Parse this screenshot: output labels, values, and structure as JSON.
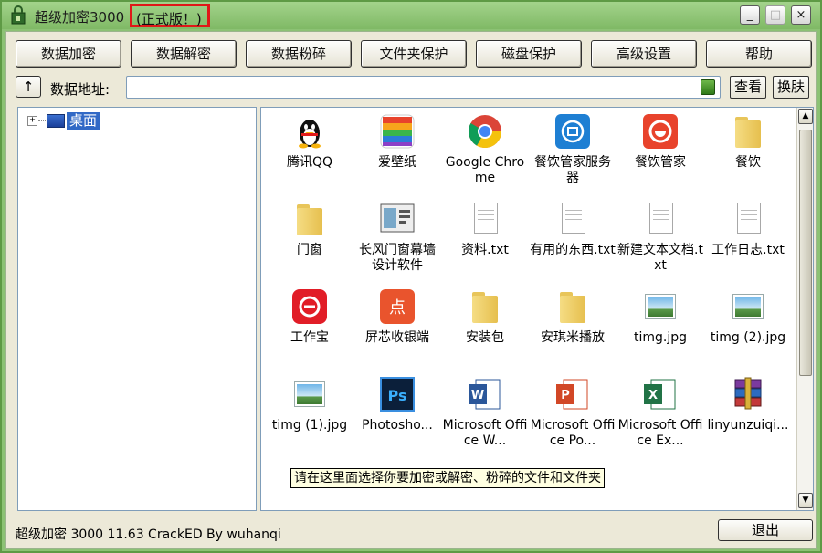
{
  "window": {
    "title": "超级加密3000",
    "edition": "(正式版！)",
    "controls": {
      "minimize": "_",
      "maximize": "□",
      "close": "×"
    }
  },
  "toolbar": {
    "buttons": [
      "数据加密",
      "数据解密",
      "数据粉碎",
      "文件夹保护",
      "磁盘保护",
      "高级设置",
      "帮助"
    ]
  },
  "address": {
    "up_label": "↑",
    "label": "数据地址:",
    "value": "",
    "view_button": "查看",
    "skin_button": "换肤"
  },
  "tree": {
    "expander": "+",
    "root_label": "桌面"
  },
  "files": [
    {
      "label": "腾讯QQ",
      "icon": "qq-penguin-icon"
    },
    {
      "label": "爱壁纸",
      "icon": "wallpaper-app-icon"
    },
    {
      "label": "Google Chrome",
      "icon": "chrome-icon"
    },
    {
      "label": "餐饮管家服务器",
      "icon": "catering-server-icon"
    },
    {
      "label": "餐饮管家",
      "icon": "catering-icon"
    },
    {
      "label": "餐饮",
      "icon": "folder-icon"
    },
    {
      "label": "门窗",
      "icon": "folder-icon"
    },
    {
      "label": "长风门窗幕墙设计软件",
      "icon": "design-software-icon"
    },
    {
      "label": "资料.txt",
      "icon": "text-file-icon"
    },
    {
      "label": "有用的东西.txt",
      "icon": "text-file-icon"
    },
    {
      "label": "新建文本文档.txt",
      "icon": "text-file-icon"
    },
    {
      "label": "工作日志.txt",
      "icon": "text-file-icon"
    },
    {
      "label": "工作宝",
      "icon": "workbao-icon"
    },
    {
      "label": "屏芯收银端",
      "icon": "cashier-icon"
    },
    {
      "label": "安装包",
      "icon": "folder-icon"
    },
    {
      "label": "安琪米播放",
      "icon": "folder-icon"
    },
    {
      "label": "timg.jpg",
      "icon": "image-file-icon"
    },
    {
      "label": "timg (2).jpg",
      "icon": "image-file-icon"
    },
    {
      "label": "timg (1).jpg",
      "icon": "image-file-icon"
    },
    {
      "label": "Photosho...",
      "icon": "photoshop-icon"
    },
    {
      "label": "Microsoft Office W...",
      "icon": "word-icon"
    },
    {
      "label": "Microsoft Office Po...",
      "icon": "powerpoint-icon"
    },
    {
      "label": "Microsoft Office Ex...",
      "icon": "excel-icon"
    },
    {
      "label": "linyunzuiqi...",
      "icon": "winrar-icon"
    }
  ],
  "tooltip": "请在这里面选择你要加密或解密、粉碎的文件和文件夹",
  "status": {
    "text": "超级加密 3000 11.63  CrackED By wuhanqi",
    "exit_button": "退出"
  },
  "colors": {
    "title_bar": "#8cc274",
    "edition_border": "#e01818",
    "selection": "#3169c6",
    "tooltip_bg": "#ffffe1"
  }
}
